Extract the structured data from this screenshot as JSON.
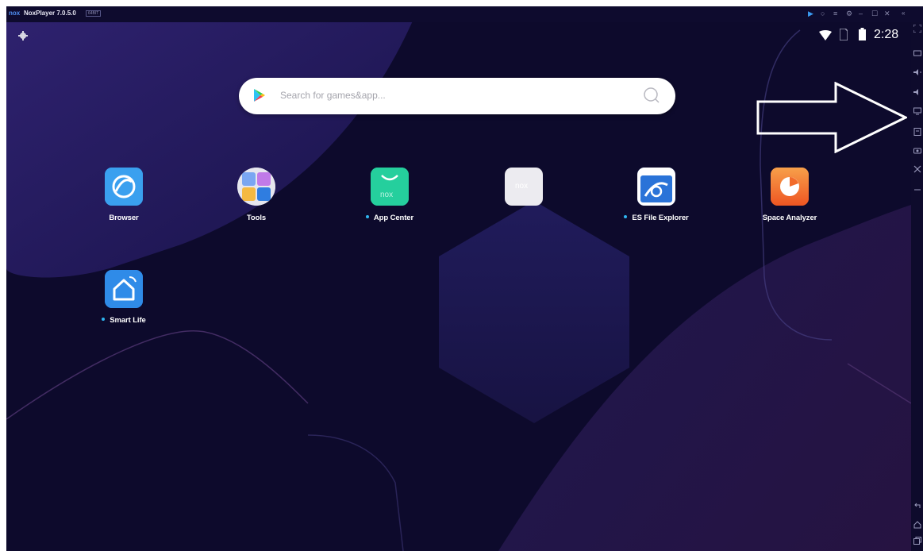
{
  "window": {
    "logo": "nox",
    "title": "NoxPlayer 7.0.5.0",
    "badge": "64BIT"
  },
  "status_bar": {
    "time": "2:28",
    "icons": [
      "gear-icon",
      "wifi-icon",
      "sim-card-icon",
      "battery-icon"
    ]
  },
  "search": {
    "placeholder": "Search for games&app..."
  },
  "apps": [
    {
      "label": "Browser",
      "dot": false
    },
    {
      "label": "Tools",
      "dot": false
    },
    {
      "label": "App Center",
      "dot": true,
      "icon_text": "nox"
    },
    {
      "label": "",
      "dot": false,
      "icon_text": "nox"
    },
    {
      "label": "ES File Explorer",
      "dot": true
    },
    {
      "label": "Space Analyzer",
      "dot": false
    },
    {
      "label": "Smart Life",
      "dot": true
    }
  ],
  "colors": {
    "background": "#0d0a2c",
    "browser": "#3aa0ef",
    "app_center": "#25cf9d",
    "es_file": "#2a73d8",
    "space_analyzer": "#f26b2a",
    "smart_life": "#2f8be8",
    "dot": "#2fb5f0"
  }
}
